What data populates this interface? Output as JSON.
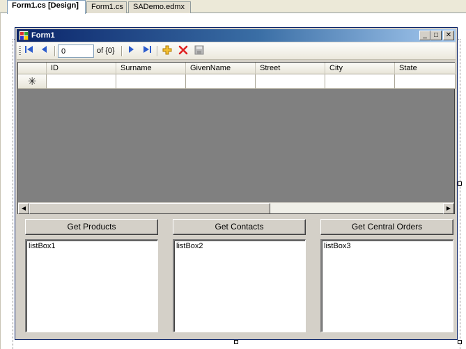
{
  "tabs": [
    {
      "label": "Form1.cs [Design]",
      "active": true
    },
    {
      "label": "Form1.cs",
      "active": false
    },
    {
      "label": "SADemo.edmx",
      "active": false
    }
  ],
  "form": {
    "title": "Form1",
    "caption_buttons": {
      "minimize": "_",
      "maximize": "□",
      "close": "✕"
    }
  },
  "navigator": {
    "position_value": "0",
    "count_label": "of {0}",
    "icons": [
      "move-first-icon",
      "move-previous-icon",
      "move-next-icon",
      "move-last-icon",
      "add-new-icon",
      "delete-icon",
      "save-icon"
    ]
  },
  "grid": {
    "columns": [
      "ID",
      "Surname",
      "GivenName",
      "Street",
      "City",
      "State"
    ],
    "new_row_marker": "✳"
  },
  "buttons": {
    "products": "Get Products",
    "contacts": "Get Contacts",
    "orders": "Get Central Orders"
  },
  "listboxes": {
    "one": "listBox1",
    "two": "listBox2",
    "three": "listBox3"
  },
  "colors": {
    "title_start": "#0a246a",
    "title_end": "#a6caf0",
    "grid_bg": "#808080",
    "nav_icon": "#2c5ccd",
    "add_icon": "#e8a317",
    "delete_icon": "#e02020"
  }
}
